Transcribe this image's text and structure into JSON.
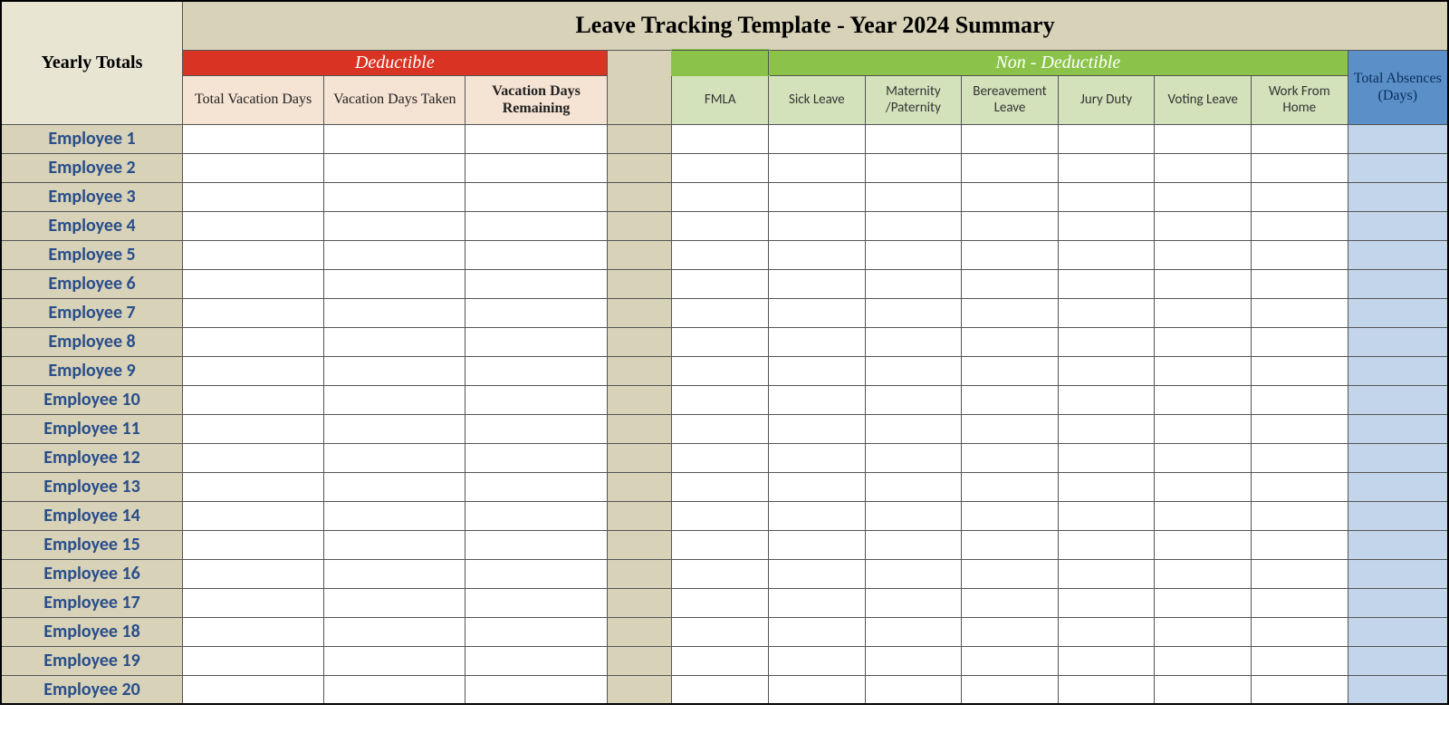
{
  "title": "Leave Tracking Template - Year 2024 Summary",
  "corner_label": "Yearly Totals",
  "deductible": {
    "header": "Deductible",
    "cols": [
      "Total Vacation Days",
      "Vacation Days Taken",
      "Vacation Days Remaining"
    ]
  },
  "nondeductible": {
    "header": "Non - Deductible",
    "cols": [
      "FMLA",
      "Sick Leave",
      "Maternity /Paternity",
      "Bereavement Leave",
      "Jury Duty",
      "Voting Leave",
      "Work From Home"
    ]
  },
  "total_absences_header": "Total Absences (Days)",
  "employees": [
    "Employee 1",
    "Employee 2",
    "Employee 3",
    "Employee 4",
    "Employee 5",
    "Employee 6",
    "Employee 7",
    "Employee 8",
    "Employee 9",
    "Employee 10",
    "Employee 11",
    "Employee 12",
    "Employee 13",
    "Employee 14",
    "Employee 15",
    "Employee 16",
    "Employee 17",
    "Employee 18",
    "Employee 19",
    "Employee 20"
  ]
}
